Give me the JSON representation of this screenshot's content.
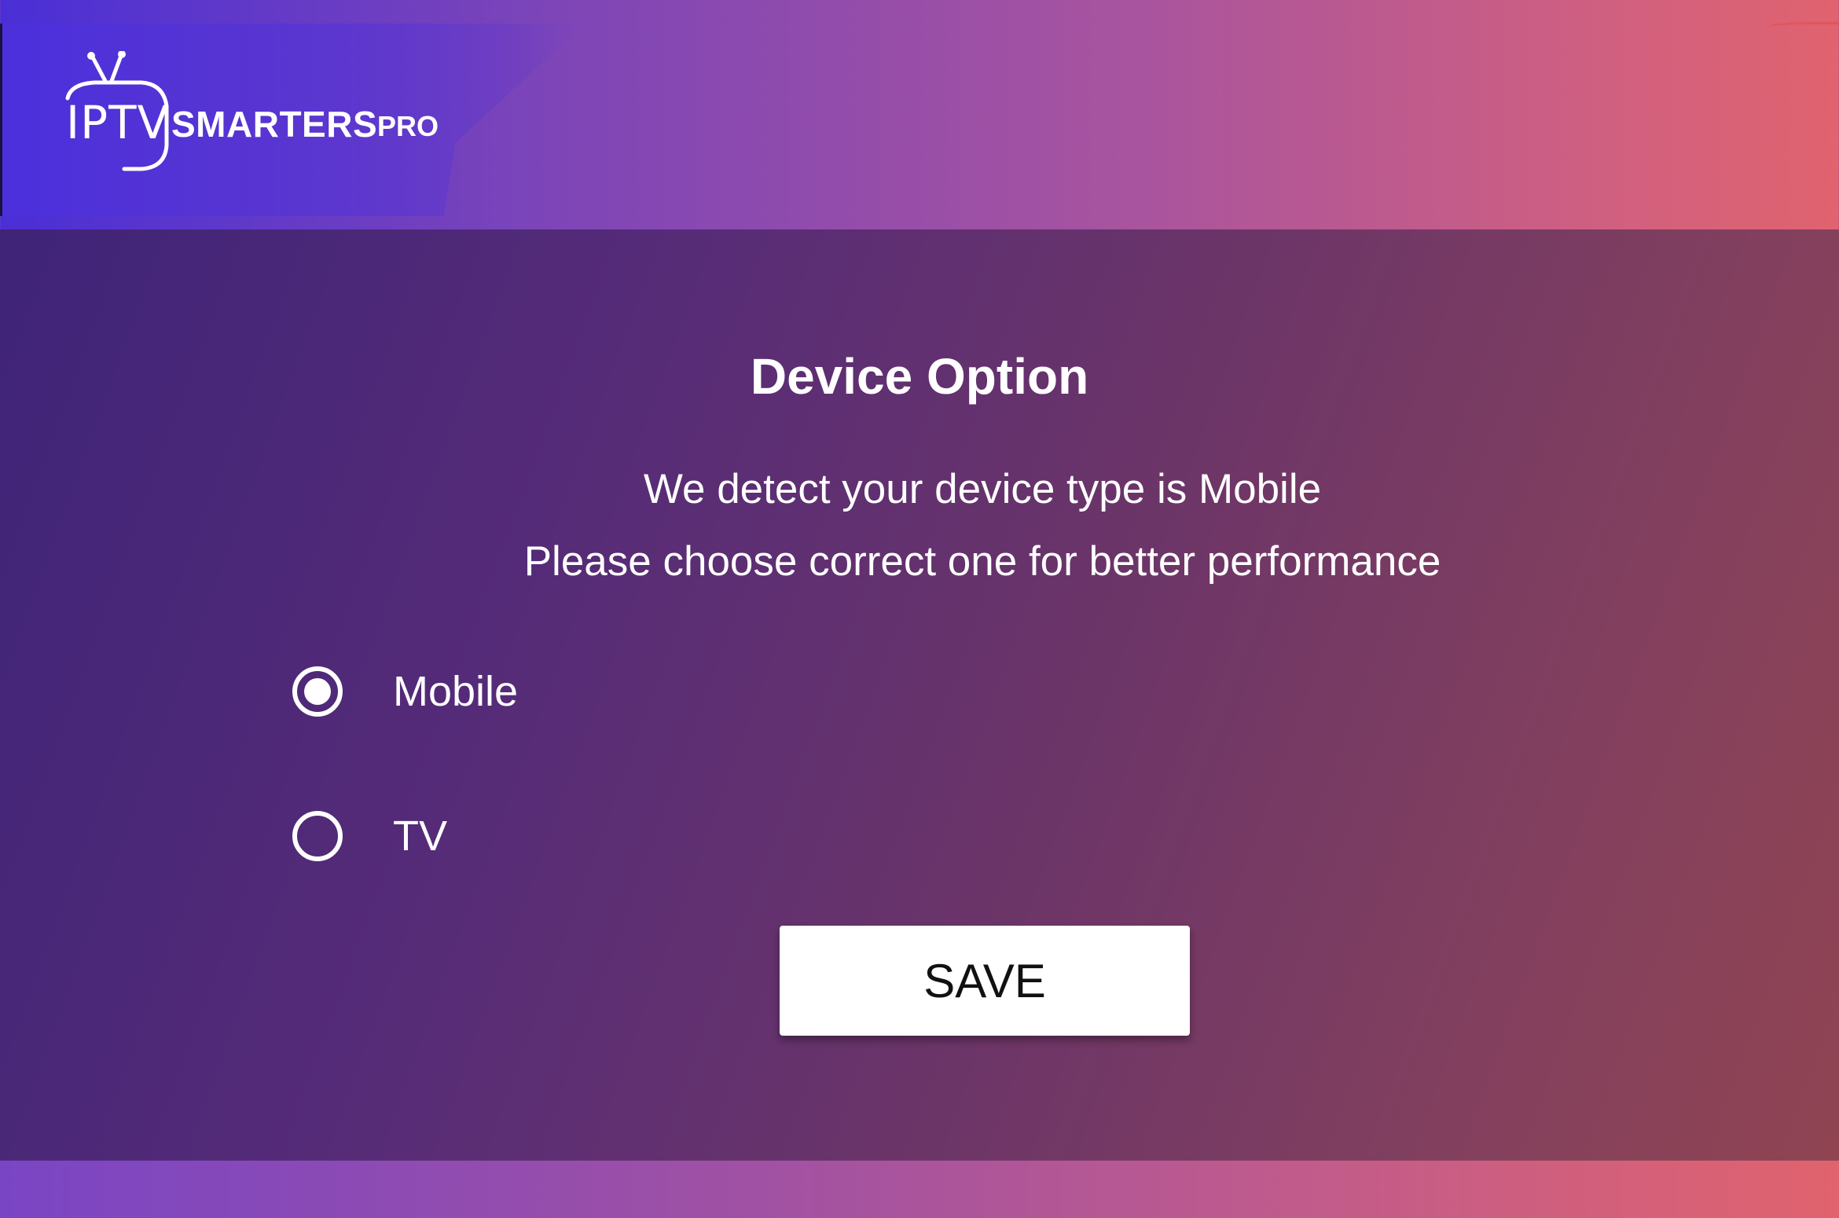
{
  "header": {
    "logo": {
      "iptv": "IPTV",
      "smarters": "SMARTERS",
      "pro": "PRO",
      "icon": "tv-icon"
    }
  },
  "dialog": {
    "title": "Device Option",
    "message_line_1": "We detect your device type is Mobile",
    "message_line_2": "Please choose correct one for better performance",
    "options": [
      {
        "label": "Mobile",
        "selected": true
      },
      {
        "label": "TV",
        "selected": false
      }
    ],
    "save_label": "SAVE"
  },
  "colors": {
    "background_start": "#4a2fd6",
    "background_end": "#e0636e",
    "panel_start": "#3f2478",
    "panel_end": "#904452",
    "button_bg": "#ffffff",
    "button_text": "#111111"
  }
}
